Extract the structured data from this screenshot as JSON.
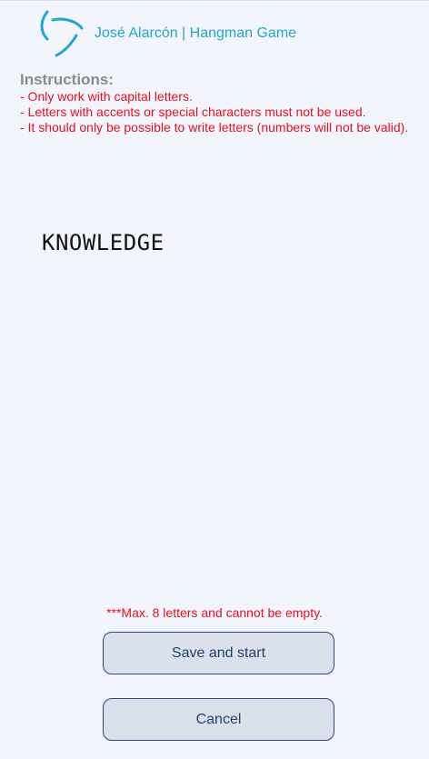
{
  "header": {
    "title": "José Alarcón | Hangman Game",
    "logo_icon": "triangular-swirl-logo",
    "accent_color": "#1fa8c9"
  },
  "instructions": {
    "heading": "Instructions:",
    "lines": [
      "- Only work with capital letters.",
      "- Letters with accents or special characters must not be used.",
      "- It should only be possible to write letters (numbers will not be valid)."
    ]
  },
  "word_input": {
    "value": "KNOWLEDGE"
  },
  "validation": {
    "note": "***Max. 8 letters and cannot be empty."
  },
  "buttons": {
    "save_label": "Save and start",
    "cancel_label": "Cancel"
  },
  "colors": {
    "background": "#f3f5fc",
    "warning": "#e8111b",
    "button_bg": "#dbe1ec",
    "button_border": "#2f4a73"
  }
}
